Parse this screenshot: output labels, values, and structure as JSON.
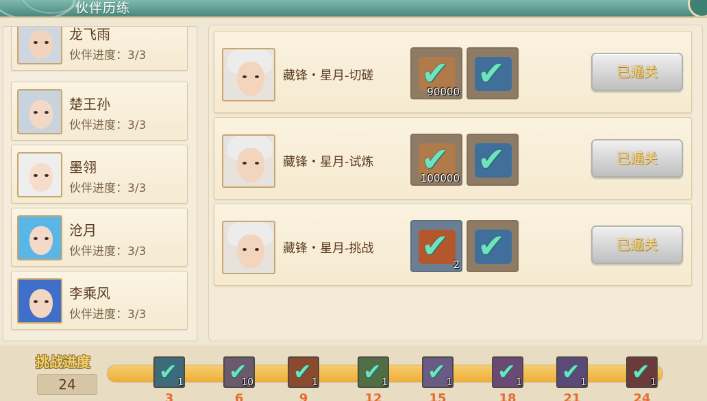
{
  "header": {
    "title": "伙伴历练"
  },
  "partners": [
    {
      "name": "龙飞雨",
      "progress": "伙伴进度：3/3",
      "hair": "#cfd6df",
      "skin": "#f2d3bd"
    },
    {
      "name": "楚王孙",
      "progress": "伙伴进度：3/3",
      "hair": "#c8d3dd",
      "skin": "#f3d8c5"
    },
    {
      "name": "墨翎",
      "progress": "伙伴进度：3/3",
      "hair": "#eeeeee",
      "skin": "#f6dccb"
    },
    {
      "name": "沧月",
      "progress": "伙伴进度：3/3",
      "hair": "#5ab6e6",
      "skin": "#f4d8c8"
    },
    {
      "name": "李乘风",
      "progress": "伙伴进度：3/3",
      "hair": "#3f6fc9",
      "skin": "#f3d6c2"
    }
  ],
  "missions": [
    {
      "name": "藏锋・星月-切磋",
      "reward1_icon": "gold-bag-icon",
      "reward1_qty": "90000",
      "reward2_icon": "skill-book-icon",
      "button": "已通关"
    },
    {
      "name": "藏锋・星月-试炼",
      "reward1_icon": "gold-bag-icon",
      "reward1_qty": "100000",
      "reward2_icon": "skill-book-icon",
      "button": "已通关"
    },
    {
      "name": "藏锋・星月-挑战",
      "reward1_icon": "scroll-box-icon",
      "reward1_qty": "2",
      "reward2_icon": "skill-book-icon",
      "button": "已通关"
    }
  ],
  "challenge": {
    "label": "挑战进度",
    "value": "24",
    "progress_fraction": 1.0,
    "milestones": [
      {
        "threshold": "3",
        "qty": "1",
        "color": "#3d6b7c"
      },
      {
        "threshold": "6",
        "qty": "10",
        "color": "#6b5a6e"
      },
      {
        "threshold": "9",
        "qty": "1",
        "color": "#8a4a2e"
      },
      {
        "threshold": "12",
        "qty": "1",
        "color": "#4f6e44"
      },
      {
        "threshold": "15",
        "qty": "1",
        "color": "#6a5b86"
      },
      {
        "threshold": "18",
        "qty": "1",
        "color": "#6a4a74"
      },
      {
        "threshold": "21",
        "qty": "1",
        "color": "#5a4a78"
      },
      {
        "threshold": "24",
        "qty": "1",
        "color": "#6b3a3a"
      }
    ]
  }
}
